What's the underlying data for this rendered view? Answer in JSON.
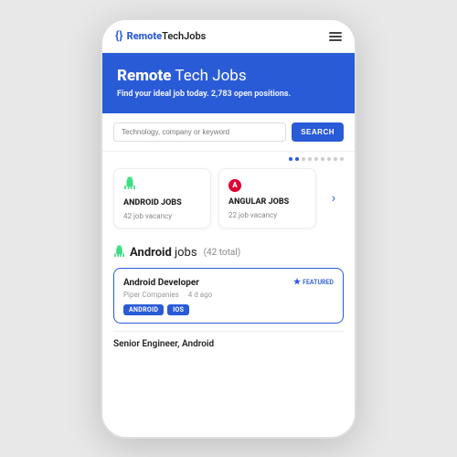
{
  "navbar": {
    "brand_icon": "{}",
    "brand_name": "RemoteTechJobs",
    "brand_remote": "Remote",
    "brand_tech": "TechJobs"
  },
  "hero": {
    "title_bold": "Remote",
    "title_rest": " Tech Jobs",
    "subtitle": "Find your ideal job today.",
    "open_positions": "2,783",
    "open_positions_label": "open positions."
  },
  "search": {
    "placeholder": "Technology, company or keyword",
    "button_label": "SEARCH"
  },
  "dots": [
    true,
    true,
    false,
    false,
    false,
    false,
    false,
    false,
    false
  ],
  "categories": [
    {
      "icon": "android",
      "title": "ANDROID JOBS",
      "vacancy": "42 job vacancy"
    },
    {
      "icon": "angular",
      "title": "ANGULAR JOBS",
      "vacancy": "22 job vacancy"
    }
  ],
  "section": {
    "icon": "android",
    "title_bold": "Android",
    "title_rest": " jobs",
    "count": "(42 total)"
  },
  "jobs": [
    {
      "title": "Android Developer",
      "featured": true,
      "featured_label": "FEATURED",
      "company": "Piper Companies",
      "time": "4 d ago",
      "tags": [
        "ANDROID",
        "IOS"
      ]
    },
    {
      "title": "Senior Engineer, Android",
      "featured": false,
      "company": "",
      "time": "",
      "tags": []
    }
  ]
}
